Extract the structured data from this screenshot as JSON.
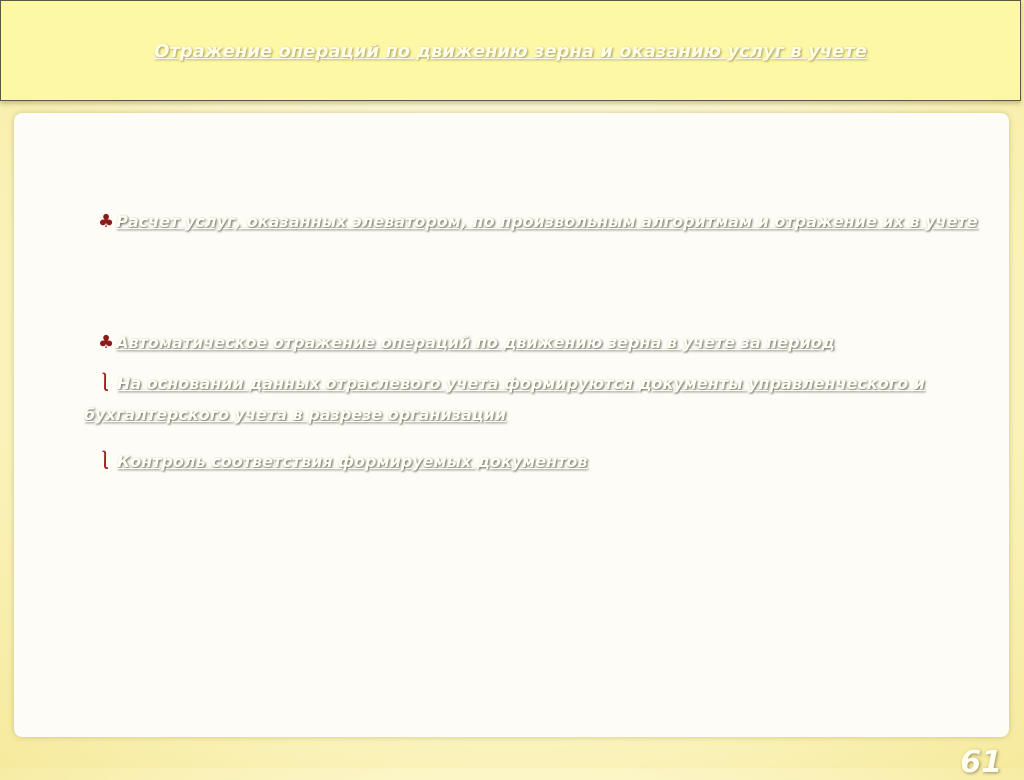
{
  "slide": {
    "title": "Отражение операций по движению зерна и оказанию услуг в учете",
    "items": [
      {
        "bullet": "♣",
        "text": "Расчет услуг, оказанных элеватором, по произвольным алгоритмам и отражение их в учете"
      },
      {
        "bullet": "♣",
        "text": "Автоматическое отражение операций по движению зерна в учете за период",
        "subitems": [
          {
            "bullet": "⎱",
            "text": "На основании данных отраслевого учета формируются документы управленческого и бухгалтерского учета в разрезе организации"
          },
          {
            "bullet": "⎱",
            "text": "Контроль соответствия формируемых документов"
          }
        ]
      }
    ],
    "page_number": "61"
  }
}
